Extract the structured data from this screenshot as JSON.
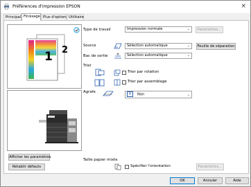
{
  "window": {
    "title": "Préférences d'impression EPSON",
    "close_glyph": "×"
  },
  "tabs": [
    {
      "label": "Principal"
    },
    {
      "label": "Finissage"
    },
    {
      "label": "Plus d'options"
    },
    {
      "label": "Utilitaire"
    }
  ],
  "preview": {
    "page_front": "1",
    "page_back": "2"
  },
  "type_travail": {
    "label": "Type de travail",
    "value": "Impression normale",
    "params_button": "Paramètres..."
  },
  "source": {
    "label": "Source",
    "value": "Sélection automatique"
  },
  "bac_sortie": {
    "label": "Bac de sortie",
    "value": "Sélection automatique"
  },
  "feuille_separation": {
    "label": "Feuille de séparation"
  },
  "trier": {
    "label": "Trier",
    "rotation_label": "Trier par rotation",
    "assemblage_label": "Trier par assemblage"
  },
  "agrafe": {
    "label": "Agrafe",
    "value": "Non"
  },
  "left_buttons": {
    "show_settings": "Afficher les paramètres",
    "reset_defaults": "Rétablir défauts"
  },
  "taille_mixte": {
    "label": "Taille papier mixte",
    "specify_orientation": "Spécifier l'orientation",
    "params_button": "Paramètres..."
  },
  "footer": {
    "ok": "OK",
    "cancel": "Annuler",
    "help": "Aide"
  }
}
